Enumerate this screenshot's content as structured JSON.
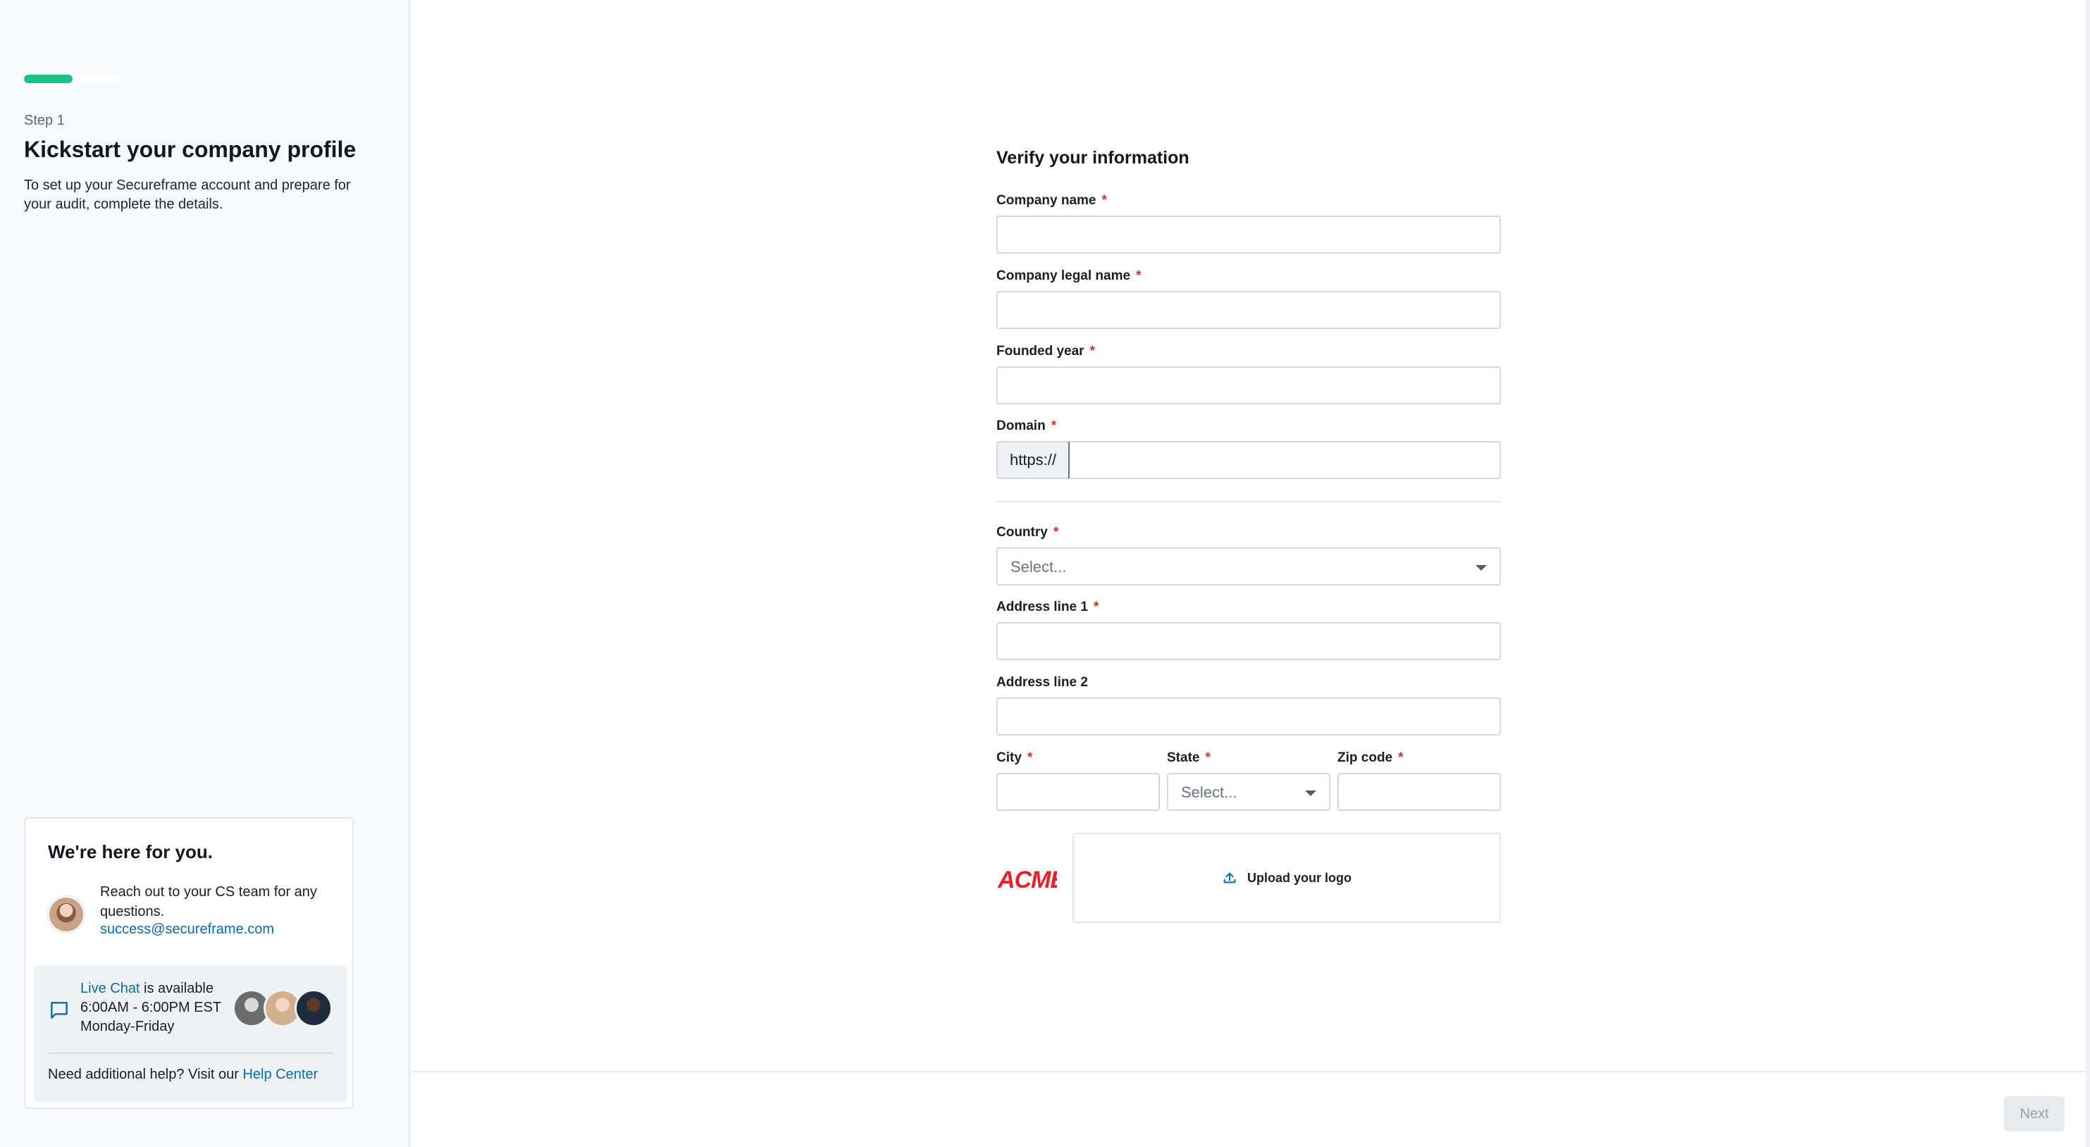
{
  "sidebar": {
    "progress_fraction": 0.5,
    "step_label": "Step 1",
    "title": "Kickstart your company profile",
    "description": "To set up your Secureframe account and prepare for your audit, complete the details.",
    "help_card": {
      "title": "We're here for you.",
      "cs_text": "Reach out to your CS team for any questions.",
      "cs_email": "success@secureframe.com",
      "live_chat_link": "Live Chat",
      "live_chat_suffix": " is available",
      "hours": "6:00AM - 6:00PM EST",
      "days": "Monday-Friday",
      "additional_help_prefix": "Need additional help? Visit our ",
      "help_center_link": "Help Center"
    }
  },
  "form": {
    "title": "Verify your information",
    "required_marker": "*",
    "fields": {
      "company_name": {
        "label": "Company name",
        "value": ""
      },
      "company_legal_name": {
        "label": "Company legal name",
        "value": ""
      },
      "founded_year": {
        "label": "Founded year",
        "value": ""
      },
      "domain": {
        "label": "Domain",
        "prefix": "https://",
        "value": ""
      },
      "country": {
        "label": "Country",
        "placeholder": "Select..."
      },
      "address_line_1": {
        "label": "Address line 1",
        "value": ""
      },
      "address_line_2": {
        "label": "Address line 2",
        "value": ""
      },
      "city": {
        "label": "City",
        "value": ""
      },
      "state": {
        "label": "State",
        "placeholder": "Select..."
      },
      "zip_code": {
        "label": "Zip code",
        "value": ""
      }
    },
    "logo": {
      "preview_text": "ACME",
      "upload_label": "Upload your logo"
    }
  },
  "footer": {
    "next_label": "Next"
  },
  "colors": {
    "accent_green": "#1dc283",
    "link_blue": "#0b6aa8",
    "required_red": "#d93025",
    "logo_red": "#e8202a"
  },
  "icons": {
    "chat": "chat-bubble-icon",
    "upload": "upload-icon",
    "caret": "chevron-down-icon"
  }
}
